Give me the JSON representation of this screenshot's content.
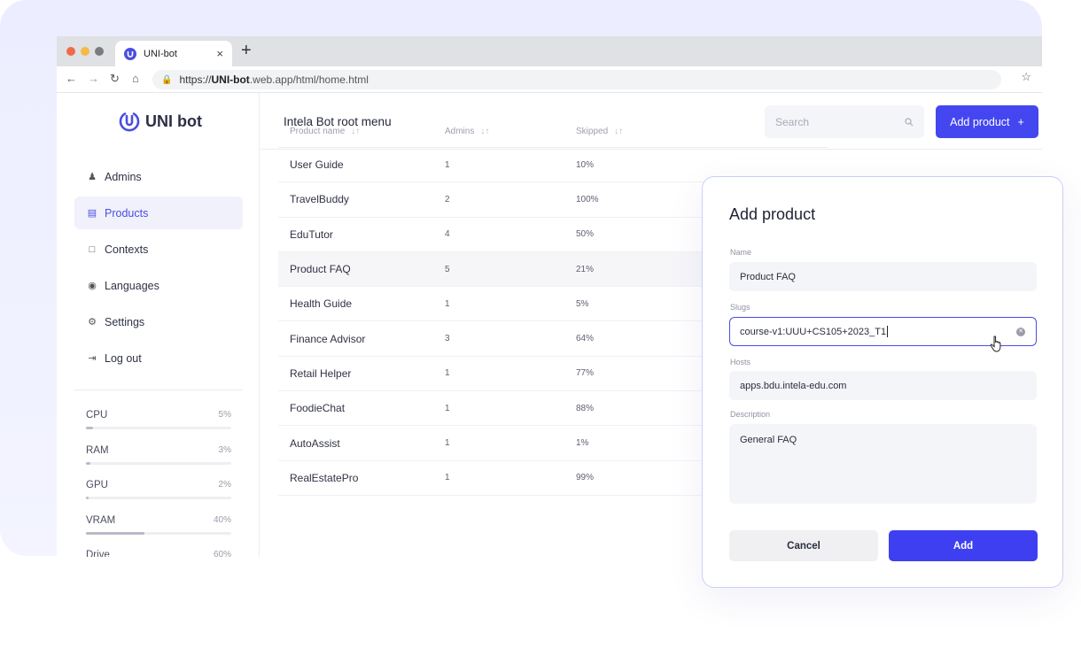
{
  "browser": {
    "tab_title": "UNI-bot",
    "tab_close": "×",
    "new_tab": "+",
    "url_scheme": "https://",
    "url_host": "UNI-bot",
    "url_rest": ".web.app/html/home.html"
  },
  "sidebar": {
    "logo_text": "UNI bot",
    "items": [
      {
        "label": "Admins",
        "icon": "users-icon"
      },
      {
        "label": "Products",
        "icon": "list-icon",
        "active": true
      },
      {
        "label": "Contexts",
        "icon": "help-box-icon"
      },
      {
        "label": "Languages",
        "icon": "globe-icon"
      },
      {
        "label": "Settings",
        "icon": "gear-icon"
      },
      {
        "label": "Log out",
        "icon": "logout-icon"
      }
    ],
    "resources": [
      {
        "name": "CPU",
        "value": "5%",
        "percent": 5
      },
      {
        "name": "RAM",
        "value": "3%",
        "percent": 3
      },
      {
        "name": "GPU",
        "value": "2%",
        "percent": 2
      },
      {
        "name": "VRAM",
        "value": "40%",
        "percent": 40
      },
      {
        "name": "Drive",
        "value": "60%",
        "percent": 60
      }
    ]
  },
  "header": {
    "title": "Intela Bot root menu",
    "search_placeholder": "Search",
    "add_product_label": "Add product",
    "add_product_icon": "+"
  },
  "table": {
    "columns": [
      "Product name",
      "Admins",
      "Skipped"
    ],
    "rows": [
      {
        "name": "User Guide",
        "admins": "1",
        "skipped": "10%"
      },
      {
        "name": "TravelBuddy",
        "admins": "2",
        "skipped": "100%"
      },
      {
        "name": "EduTutor",
        "admins": "4",
        "skipped": "50%"
      },
      {
        "name": "Product FAQ",
        "admins": "5",
        "skipped": "21%"
      },
      {
        "name": "Health Guide",
        "admins": "1",
        "skipped": "5%"
      },
      {
        "name": "Finance Advisor",
        "admins": "3",
        "skipped": "64%"
      },
      {
        "name": "Retail Helper",
        "admins": "1",
        "skipped": "77%"
      },
      {
        "name": "FoodieChat",
        "admins": "1",
        "skipped": "88%"
      },
      {
        "name": "AutoAssist",
        "admins": "1",
        "skipped": "1%"
      },
      {
        "name": "RealEstatePro",
        "admins": "1",
        "skipped": "99%"
      }
    ]
  },
  "modal": {
    "title": "Add product",
    "name_label": "Name",
    "name_value": "Product FAQ",
    "slugs_label": "Slugs",
    "slugs_value": "course-v1:UUU+CS105+2023_T1",
    "hosts_label": "Hosts",
    "hosts_value": "apps.bdu.intela-edu.com",
    "description_label": "Description",
    "description_value": "General FAQ",
    "cancel_label": "Cancel",
    "add_label": "Add"
  }
}
